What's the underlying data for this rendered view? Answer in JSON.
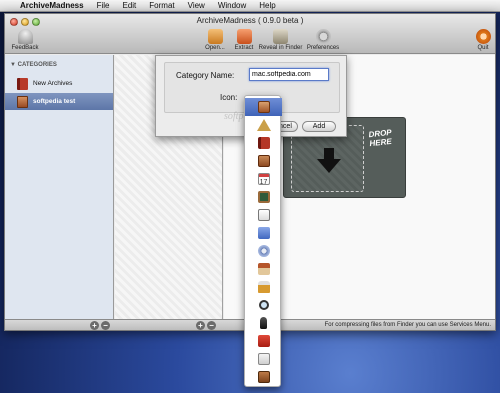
{
  "menubar": {
    "app_name": "ArchiveMadness",
    "items": [
      "File",
      "Edit",
      "Format",
      "View",
      "Window",
      "Help"
    ]
  },
  "window": {
    "title": "ArchiveMadness ( 0.9.0 beta )"
  },
  "toolbar": {
    "feedback": "FeedBack",
    "open": "Open...",
    "extract": "Extract",
    "reveal": "Reveal in Finder",
    "preferences": "Preferences",
    "quit": "Quit"
  },
  "sidebar": {
    "header": "CATEGORIES",
    "items": [
      {
        "label": "New Archives",
        "icon": "book-icon",
        "selected": false
      },
      {
        "label": "softpedia test",
        "icon": "box-icon",
        "selected": true
      }
    ]
  },
  "drop_zone": {
    "text_line1": "DROP",
    "text_line2": "HERE"
  },
  "status_bar": {
    "text": "For compressing files from Finder you can use Services Menu."
  },
  "category_dialog": {
    "name_label": "Category Name:",
    "name_value": "mac.softpedia.com",
    "icon_label": "Icon:",
    "cancel_label": "Cancel",
    "add_label": "Add"
  },
  "icon_popup": {
    "options": [
      "brown-box-icon",
      "triangle-ruler-icon",
      "red-book-icon",
      "package-icon",
      "calendar-icon",
      "chalkboard-icon",
      "clipboard-icon",
      "app-store-icon",
      "gear-icon",
      "house-icon",
      "lock-icon",
      "magnifier-icon",
      "microphone-icon",
      "red-case-icon",
      "document-icon",
      "briefcase-icon"
    ],
    "calendar_day": "17",
    "selected_index": 0
  },
  "watermark": "softpedia"
}
